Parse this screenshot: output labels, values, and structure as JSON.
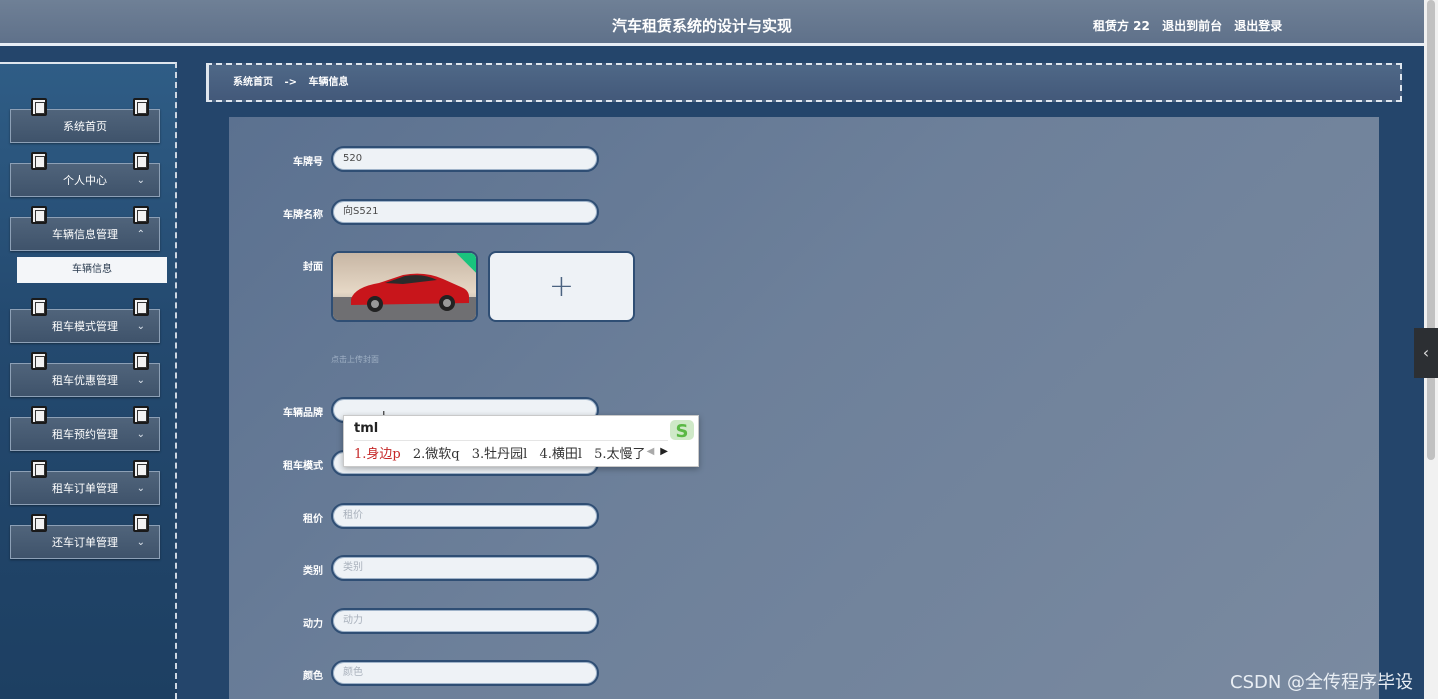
{
  "header": {
    "title": "汽车租赁系统的设计与实现",
    "user_label": "租赁方 22",
    "front_link": "退出到前台",
    "logout_link": "退出登录"
  },
  "sidebar": {
    "items": [
      {
        "label": "系统首页",
        "expandable": false
      },
      {
        "label": "个人中心",
        "expandable": true
      },
      {
        "label": "车辆信息管理",
        "expandable": true,
        "expanded": true
      },
      {
        "label": "租车模式管理",
        "expandable": true
      },
      {
        "label": "租车优惠管理",
        "expandable": true
      },
      {
        "label": "租车预约管理",
        "expandable": true
      },
      {
        "label": "租车订单管理",
        "expandable": true
      },
      {
        "label": "还车订单管理",
        "expandable": true
      }
    ],
    "submenu_active": "车辆信息"
  },
  "breadcrumb": {
    "home": "系统首页",
    "separator": "->",
    "current": "车辆信息"
  },
  "form": {
    "plate_label": "车牌号",
    "plate_value": "520",
    "name_label": "车牌名称",
    "name_value": "向S521",
    "cover_label": "封面",
    "upload_hint": "点击上传封面",
    "brand_label": "车辆品牌",
    "brand_value": "",
    "mode_label": "租车模式",
    "price_label": "租价",
    "price_placeholder": "租价",
    "category_label": "类别",
    "category_placeholder": "类别",
    "power_label": "动力",
    "power_placeholder": "动力",
    "color_label": "颜色",
    "color_placeholder": "颜色"
  },
  "ime": {
    "pinyin": "tml",
    "candidates": [
      "1.身边p",
      "2.微软q",
      "3.牡丹园l",
      "4.横田l",
      "5.太慢了"
    ]
  },
  "watermark": "CSDN @全传程序毕设",
  "colors": {
    "sidebar_bg": "#24456b",
    "panel_bg": "#6d809a",
    "accent": "#2f4e74",
    "ime_highlight": "#c62828"
  }
}
